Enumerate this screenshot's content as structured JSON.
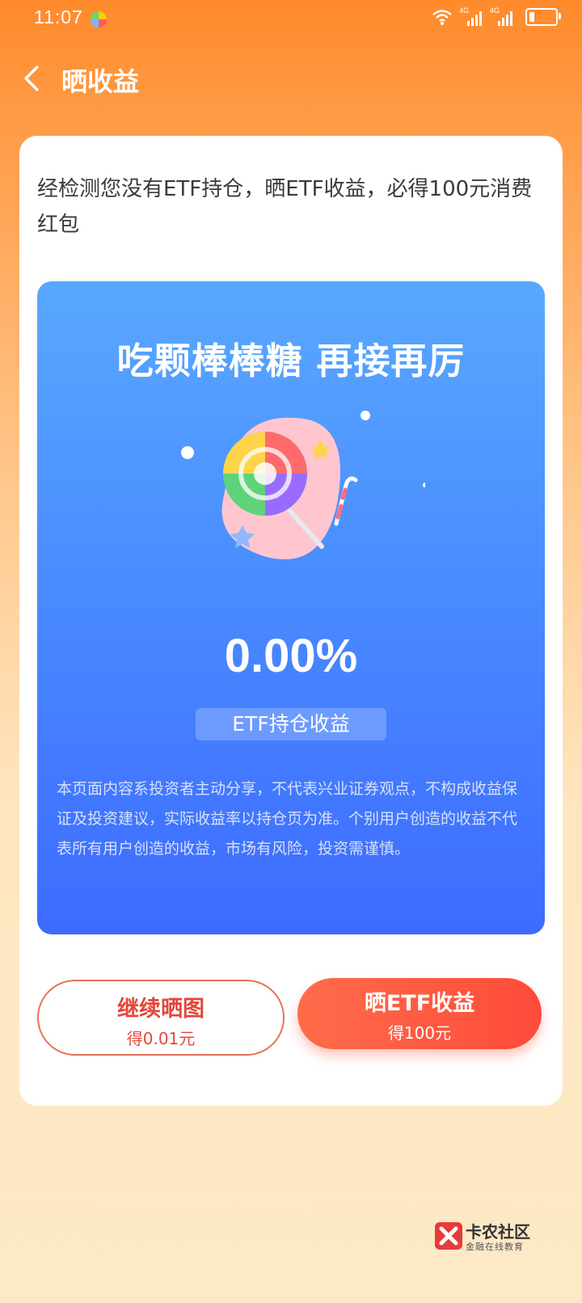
{
  "status_bar": {
    "time": "11:07",
    "signal1_label": "4G",
    "signal2_label": "4G",
    "icons": [
      "app-icon",
      "wifi-icon",
      "signal-icon",
      "signal-icon",
      "battery-icon"
    ]
  },
  "nav": {
    "title": "晒收益",
    "back_icon": "back-chevron-icon"
  },
  "card": {
    "notice": "经检测您没有ETF持仓，晒ETF收益，必得100元消费红包",
    "panel": {
      "headline": "吃颗棒棒糖 再接再厉",
      "illustration": "lollipop-illustration",
      "percent": "0.00%",
      "percent_label": "ETF持仓收益",
      "disclaimer": "本页面内容系投资者主动分享，不代表兴业证券观点，不构成收益保证及投资建议，实际收益率以持仓页为准。个别用户创造的收益不代表所有用户创造的收益，市场有风险，投资需谨慎。"
    },
    "buttons": {
      "continue": {
        "label": "继续晒图",
        "reward": "得0.01元"
      },
      "share_etf": {
        "label": "晒ETF收益",
        "reward": "得100元"
      }
    }
  },
  "watermark": {
    "title": "卡农社区",
    "subtitle": "金融在线教育"
  },
  "colors": {
    "header_orange": "#ff8a2b",
    "panel_blue": "#4a8cff",
    "button_red": "#ff5a3e"
  }
}
